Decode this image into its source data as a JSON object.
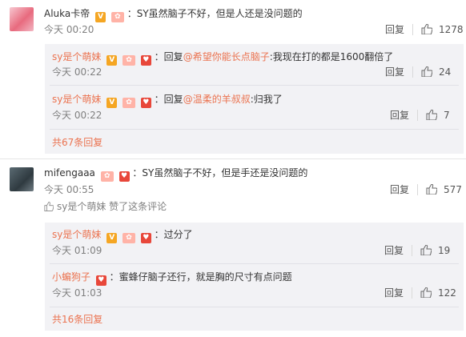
{
  "comments": [
    {
      "user": "Aluka卡帝",
      "text": "：SY虽然脑子不好，但是人还是没问题的",
      "time": "今天 00:20",
      "reply_label": "回复",
      "likes": "1278",
      "replies": [
        {
          "user": "sy是个萌妹",
          "prefix": "：回复",
          "mention": "@希望你能长点脑子",
          "text": ":我现在打的都是1600翻倍了",
          "time": "今天 00:22",
          "reply_label": "回复",
          "likes": "24"
        },
        {
          "user": "sy是个萌妹",
          "prefix": "：回复",
          "mention": "@温柔的羊叔叔",
          "text": ":归我了",
          "time": "今天 00:22",
          "reply_label": "回复",
          "likes": "7"
        }
      ],
      "more_replies": "共67条回复"
    },
    {
      "user": "mifengaaa",
      "text": "：SY虽然脑子不好，但是手还是没问题的",
      "time": "今天 00:55",
      "reply_label": "回复",
      "likes": "577",
      "liked_by": "sy是个萌妹 赞了这条评论",
      "replies": [
        {
          "user": "sy是个萌妹",
          "text": "：过分了",
          "time": "今天 01:09",
          "reply_label": "回复",
          "likes": "19"
        },
        {
          "user": "小蝙狗子",
          "text": "：蜜蜂仔脑子还行，就是胸的尺寸有点问题",
          "time": "今天 01:03",
          "reply_label": "回复",
          "likes": "122"
        }
      ],
      "more_replies": "共16条回复"
    }
  ],
  "colors": {
    "accent": "#eb7350",
    "sub_bg": "#f2f2f5",
    "text": "#333333",
    "muted": "#808080"
  },
  "icons": {
    "like": "thumbs-up-icon",
    "verified": "v-badge-icon",
    "level": "level-badge-icon",
    "member": "red-badge-icon"
  }
}
